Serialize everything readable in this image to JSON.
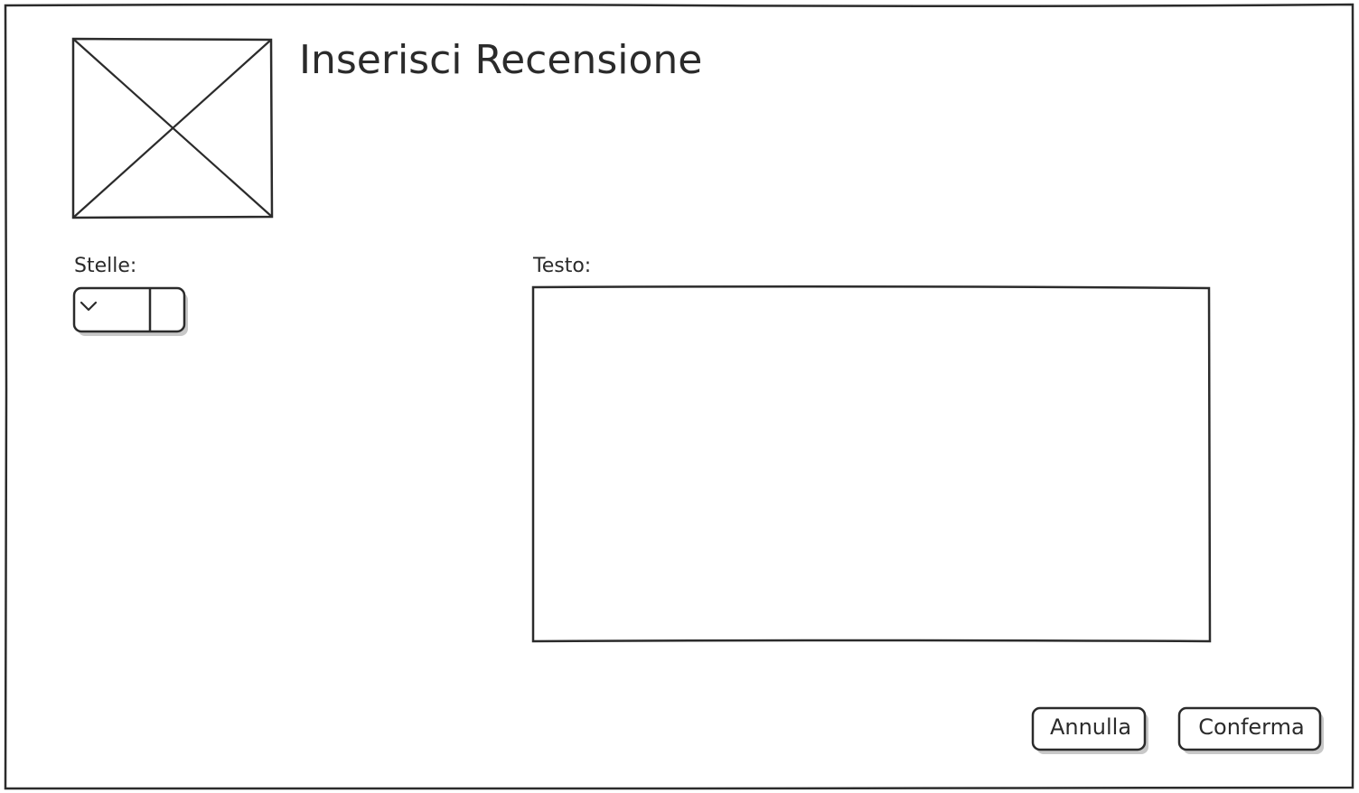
{
  "dialog": {
    "title": "Inserisci Recensione"
  },
  "stars": {
    "label": "Stelle:",
    "selected_value": ""
  },
  "text": {
    "label": "Testo:",
    "value": ""
  },
  "actions": {
    "cancel_label": "Annulla",
    "confirm_label": "Conferma"
  },
  "icons": {
    "image_placeholder": "image-placeholder-icon",
    "dropdown": "chevron-down-icon"
  },
  "colors": {
    "stroke": "#2b2b2b",
    "shadow": "#c8c8c8",
    "background": "#ffffff"
  }
}
